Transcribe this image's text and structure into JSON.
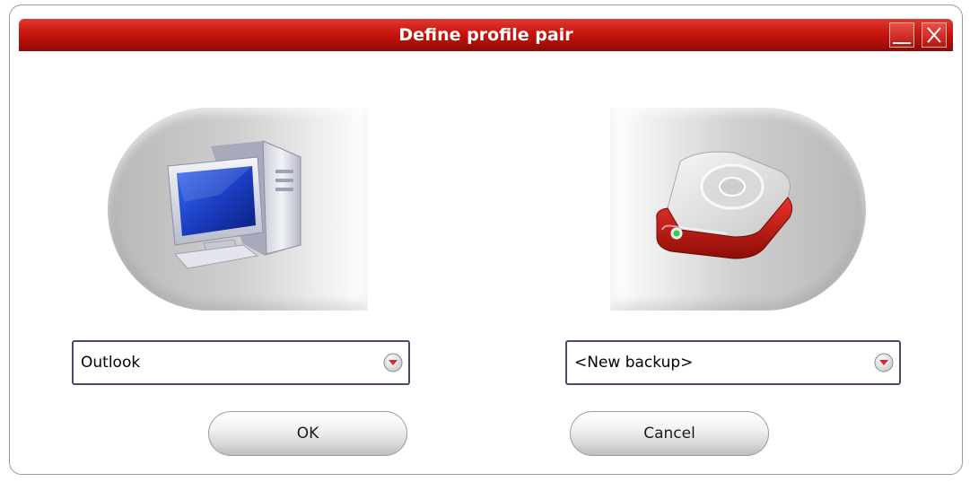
{
  "window": {
    "title": "Define profile pair"
  },
  "source": {
    "icon": "desktop-computer-icon",
    "selected": "Outlook"
  },
  "target": {
    "icon": "external-drive-icon",
    "selected": "<New backup>"
  },
  "buttons": {
    "ok": "OK",
    "cancel": "Cancel"
  },
  "colors": {
    "titlebar": "#c8140c",
    "accent": "#d01a12"
  }
}
